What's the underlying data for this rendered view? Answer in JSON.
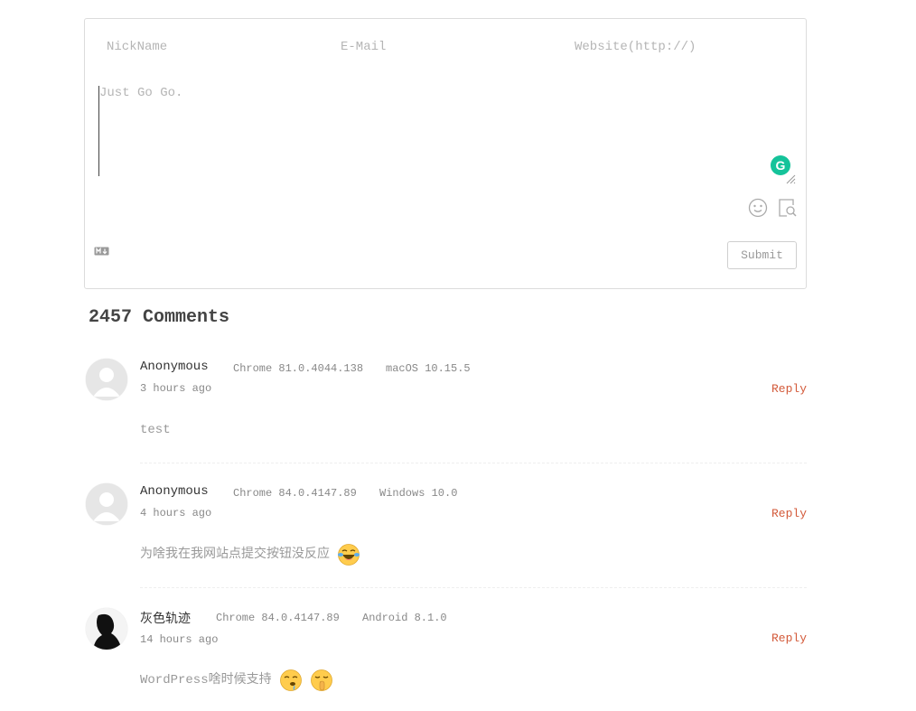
{
  "form": {
    "nick_placeholder": "NickName",
    "mail_placeholder": "E-Mail",
    "site_placeholder": "Website(http://)",
    "comment_placeholder": "Just Go Go.",
    "grammarly_letter": "G",
    "submit_label": "Submit"
  },
  "comment_count": "2457 Comments",
  "comments": [
    {
      "nick": "Anonymous",
      "browser": "Chrome 81.0.4044.138",
      "os": "macOS 10.15.5",
      "time": "3 hours ago",
      "reply": "Reply",
      "text": "test"
    },
    {
      "nick": "Anonymous",
      "browser": "Chrome 84.0.4147.89",
      "os": "Windows 10.0",
      "time": "4 hours ago",
      "reply": "Reply",
      "text": "为啥我在我网站点提交按钮没反应"
    },
    {
      "nick": "灰色轨迹",
      "browser": "Chrome 84.0.4147.89",
      "os": "Android 8.1.0",
      "time": "14 hours ago",
      "reply": "Reply",
      "text": "WordPress啥时候支持"
    }
  ],
  "icons": {
    "emoji": "emoji-icon",
    "preview": "preview-icon",
    "markdown": "markdown-icon",
    "avatar_default": "default-avatar-icon",
    "laugh_cry": "laughing-crying-face-icon",
    "drool": "drooling-face-icon",
    "shush": "shushing-face-icon"
  },
  "colors": {
    "reply": "#d35a3a",
    "grammarly": "#15c39a",
    "border": "#dcdcdc"
  }
}
